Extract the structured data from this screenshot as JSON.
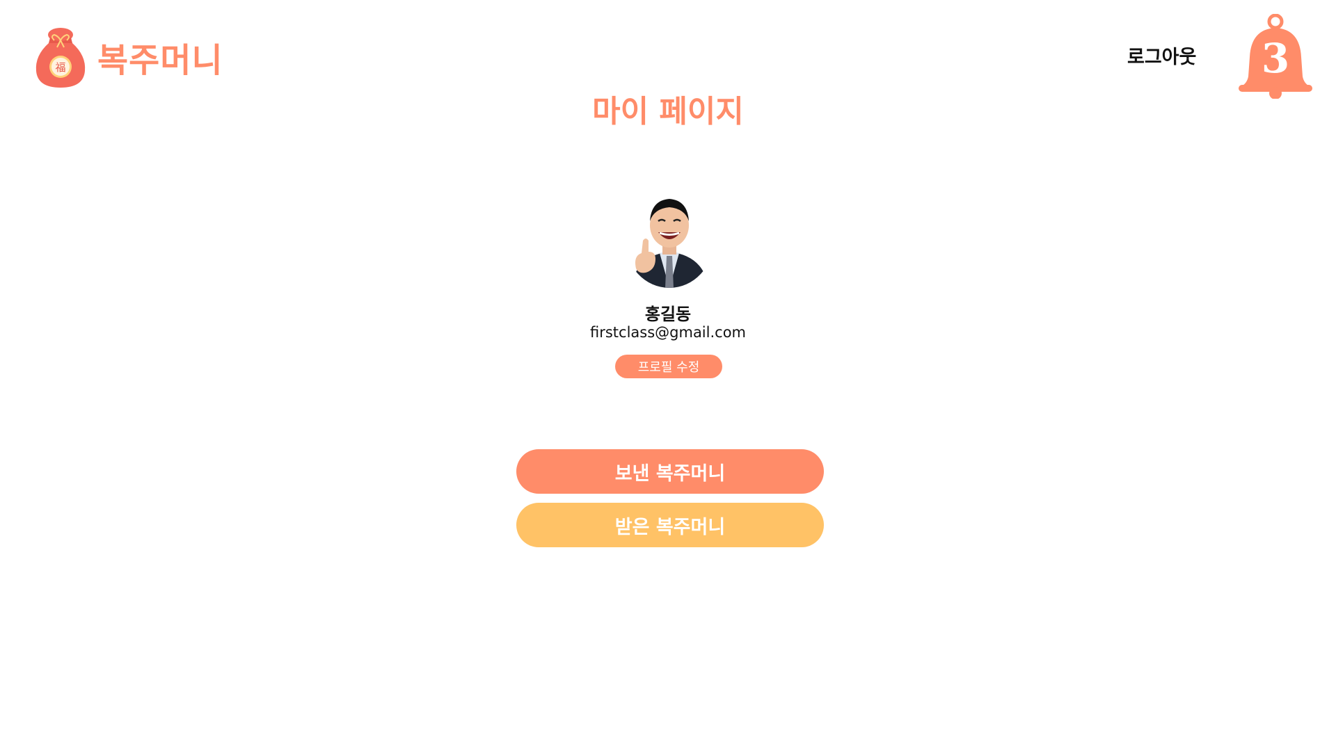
{
  "header": {
    "logo_text": "복주머니",
    "logo_icon": "lucky-bag-icon",
    "logo_char": "福",
    "logout_label": "로그아웃",
    "notification_count": "3",
    "bell_icon": "bell-icon"
  },
  "main": {
    "title": "마이 페이지"
  },
  "profile": {
    "name": "홍길동",
    "email": "firstclass@gmail.com",
    "edit_label": "프로필 수정"
  },
  "actions": {
    "sent_label": "보낸 복주머니",
    "received_label": "받은 복주머니"
  },
  "colors": {
    "primary": "#FF8C69",
    "secondary": "#FFC266"
  }
}
